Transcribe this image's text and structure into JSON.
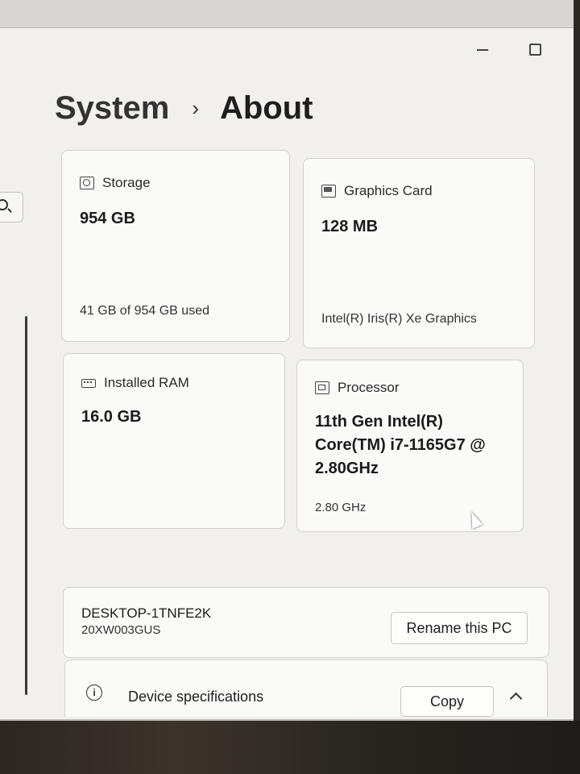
{
  "breadcrumb": {
    "parent": "System",
    "separator": "›",
    "current": "About"
  },
  "cards": {
    "storage": {
      "label": "Storage",
      "icon": "storage-icon",
      "value": "954 GB",
      "detail": "41 GB of 954 GB used"
    },
    "graphics": {
      "label": "Graphics Card",
      "icon": "graphics-card-icon",
      "value": "128 MB",
      "detail": "Intel(R) Iris(R) Xe Graphics"
    },
    "ram": {
      "label": "Installed RAM",
      "icon": "ram-icon",
      "value": "16.0 GB"
    },
    "processor": {
      "label": "Processor",
      "icon": "processor-icon",
      "value_lines": [
        "11th Gen Intel(R)",
        "Core(TM) i7-1165G7 @",
        "2.80GHz"
      ],
      "detail": "2.80 GHz"
    }
  },
  "device": {
    "name": "DESKTOP-1TNFE2K",
    "model": "20XW003GUS",
    "rename_label": "Rename this PC"
  },
  "specs": {
    "info_glyph": "i",
    "label": "Device specifications",
    "copy_label": "Copy"
  },
  "colors": {
    "background": "#f2f0ee",
    "card": "#fafaf9",
    "border": "#d2d0cd"
  }
}
